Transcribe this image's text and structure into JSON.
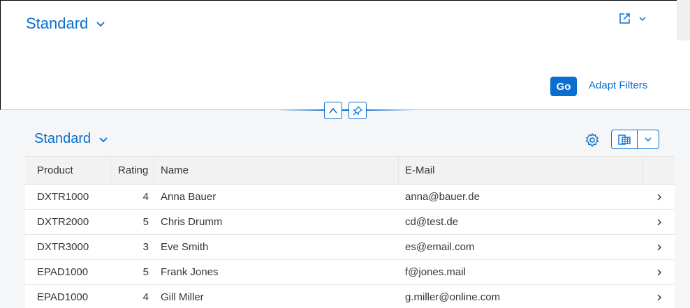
{
  "header": {
    "variant_label": "Standard",
    "go_label": "Go",
    "adapt_filters_label": "Adapt Filters"
  },
  "table": {
    "title": "Standard",
    "columns": [
      "Product",
      "Rating",
      "Name",
      "E-Mail"
    ],
    "rows": [
      {
        "product": "DXTR1000",
        "rating": "4",
        "name": "Anna Bauer",
        "email": "anna@bauer.de"
      },
      {
        "product": "DXTR2000",
        "rating": "5",
        "name": "Chris Drumm",
        "email": "cd@test.de"
      },
      {
        "product": "DXTR3000",
        "rating": "3",
        "name": "Eve Smith",
        "email": "es@email.com"
      },
      {
        "product": "EPAD1000",
        "rating": "5",
        "name": "Frank Jones",
        "email": "f@jones.mail"
      },
      {
        "product": "EPAD1000",
        "rating": "4",
        "name": "Gill Miller",
        "email": "g.miller@online.com"
      }
    ]
  },
  "icons": {
    "variant_chevron": "chevron-down-icon",
    "share": "share-icon",
    "collapse": "chevron-up-icon",
    "pin": "pin-icon",
    "settings": "gear-icon",
    "export": "export-spreadsheet-icon",
    "row_nav": "chevron-right-icon"
  },
  "colors": {
    "accent": "#0a6ed1",
    "background": "#f5f6f7",
    "header_row": "#f2f2f2"
  }
}
